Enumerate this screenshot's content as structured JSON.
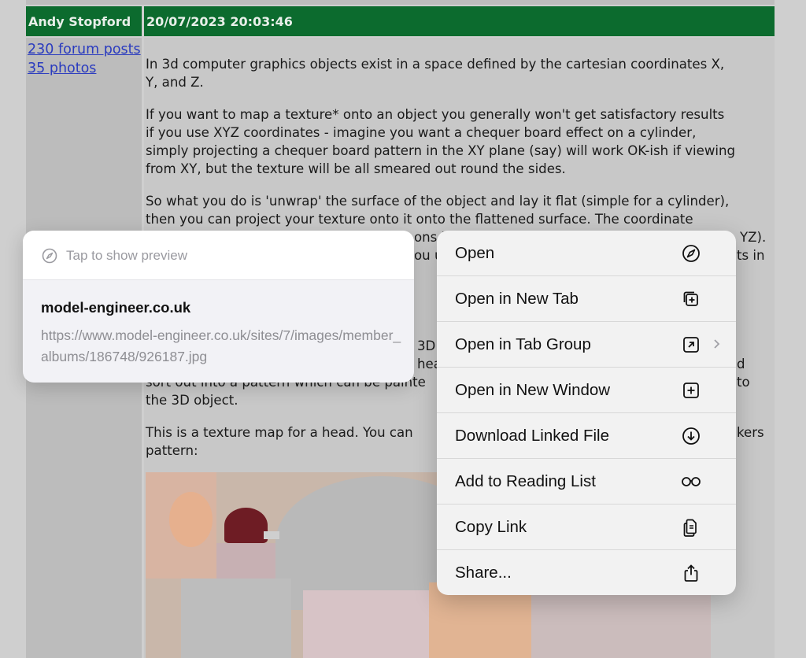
{
  "post": {
    "author": "Andy Stopford",
    "date": "20/07/2023 20:03:46",
    "forum_posts_link": "230 forum posts",
    "photos_link": "35 photos",
    "paragraphs": [
      "In 3d computer graphics objects exist in a space defined by the cartesian coordinates X,",
      "Y, and Z.",
      "If you want to map a texture* onto an object you generally won't get satisfactory results",
      "if you use XYZ coordinates - imagine you want a chequer board effect on a cylinder,",
      "simply projecting a chequer board pattern in the XY plane (say) will work OK-ish if viewing",
      "from XY, but the texture will be all smeared out round the sides.",
      "So what you do is 'unwrap' the surface of the object and lay it flat (simple for a cylinder),",
      "then you can project your texture onto it onto the flattened surface. The coordinate"
    ],
    "partial_lines": {
      "line_a_mid": "ons i",
      "line_a_end": "YZ).",
      "line_b_mid": "ou u",
      "line_b_end": "ts in",
      "line_c_mid": "3D",
      "line_d_mid": "hea",
      "line_d_end": "d",
      "line_e_start": "sort out into a pattern which can be painte",
      "line_e_end": "to",
      "line_f": "the 3D object.",
      "line_g_start": "This is a texture map for a head. You can",
      "line_g_end": "kers",
      "line_h": "pattern:"
    }
  },
  "preview": {
    "tap_text": "Tap to show preview",
    "domain": "model-engineer.co.uk",
    "url": "https://www.model-engineer.co.uk/sites/7/images/member_albums/186748/926187.jpg"
  },
  "menu": {
    "items": [
      {
        "label": "Open",
        "icon": "compass-icon"
      },
      {
        "label": "Open in New Tab",
        "icon": "new-tab-icon"
      },
      {
        "label": "Open in Tab Group",
        "icon": "tab-group-icon"
      },
      {
        "label": "Open in New Window",
        "icon": "new-window-icon"
      },
      {
        "label": "Download Linked File",
        "icon": "download-icon"
      },
      {
        "label": "Add to Reading List",
        "icon": "glasses-icon"
      },
      {
        "label": "Copy Link",
        "icon": "copy-icon"
      },
      {
        "label": "Share...",
        "icon": "share-icon"
      }
    ]
  },
  "colors": {
    "header_green": "#0c6b2e",
    "link_blue": "#2a3bbf",
    "menu_bg": "#f2f2f2"
  }
}
